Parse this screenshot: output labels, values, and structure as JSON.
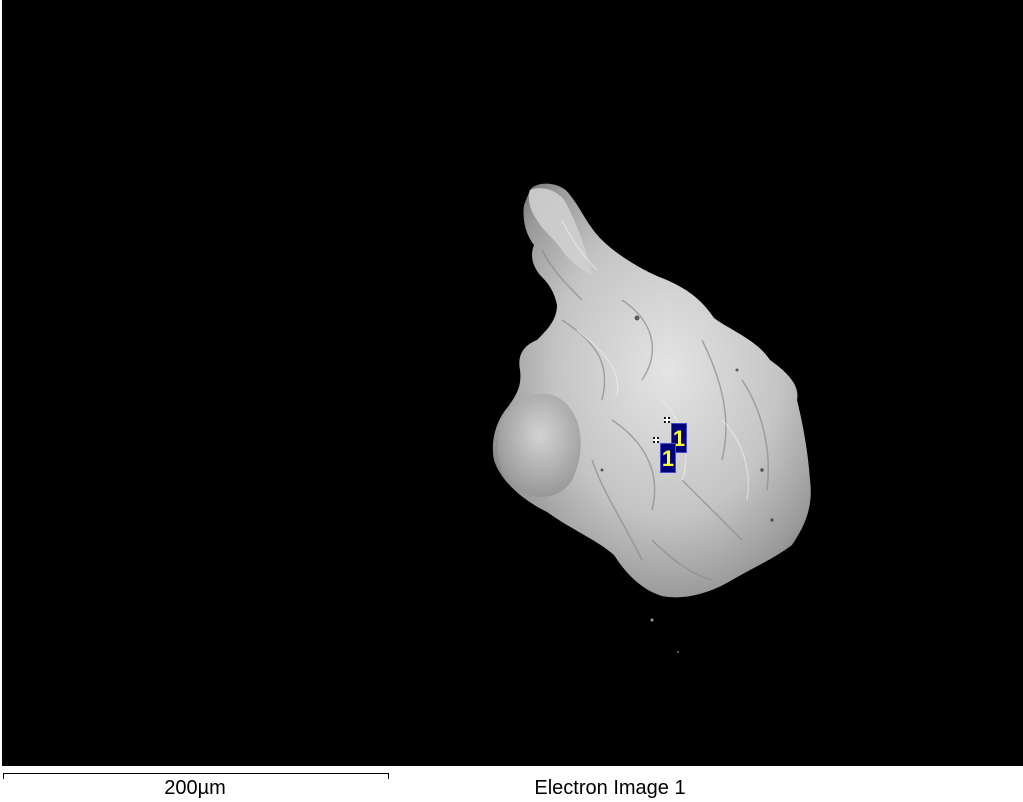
{
  "image": {
    "caption": "Electron Image 1",
    "scale_bar_label": "200µm"
  },
  "markers": [
    {
      "label": "1"
    },
    {
      "label": "1"
    }
  ],
  "colors": {
    "background": "#000000",
    "particle": "#c8c8c8",
    "marker_fill": "#00007a",
    "marker_text": "#ffff33"
  }
}
